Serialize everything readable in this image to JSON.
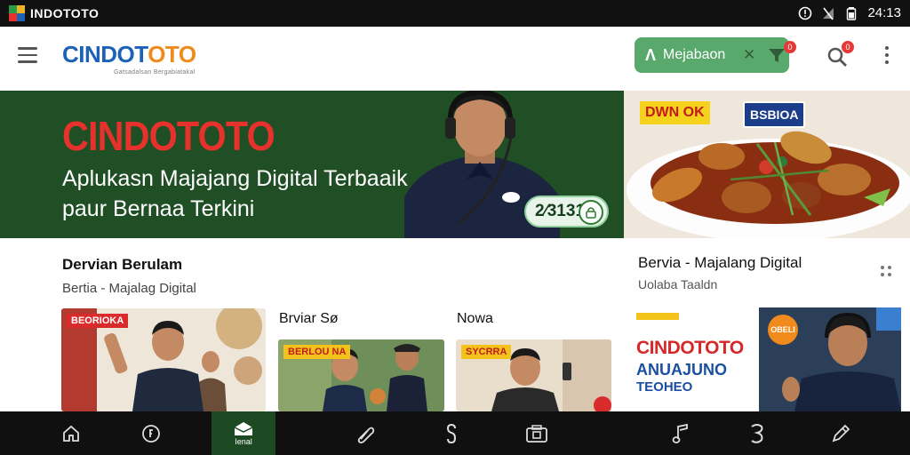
{
  "status_bar": {
    "app_name": "INDOTOTO",
    "time": "24:13"
  },
  "app_bar": {
    "brand_blue": "CINDOT",
    "brand_orange": "OTO",
    "brand_tagline": "Gatsadalsan Bergabiatakal"
  },
  "hero": {
    "title": "CINDOTOTO",
    "subtitle": "Aplukasn Majajang Digital Terbaaik paur Bernaa Terkini",
    "badge_text": "2⁄3131"
  },
  "section": {
    "title": "Dervian Berulam",
    "subtitle": "Bertia - Majalag Digital"
  },
  "cards": [
    {
      "label": "",
      "tag": "BEORIOKA"
    },
    {
      "label": "Brviar Sø",
      "tag": "BERLOU NA"
    },
    {
      "label": "Nowa",
      "tag": "SYCRRA"
    }
  ],
  "right_pane": {
    "search_pill_text": "Mejabaon",
    "filter_badge": "0",
    "search_badge": "0",
    "food_tag_left": "DWN OK",
    "food_tag_right": "BSBIOA",
    "title": "Bervia - Majalang Digital",
    "subtitle": "Uolaba Taaldn",
    "promo_title": "CINDOTOTO",
    "promo_line2": "ANUAJUNO",
    "promo_line3": "TEOHEO",
    "promo_card_badge": "OBELI"
  },
  "navbar": {
    "active_label": "Ienal"
  },
  "colors": {
    "hero_bg": "#214f25",
    "brand_blue": "#1b62b8",
    "brand_orange": "#f08a1c",
    "accent_red": "#e5322c",
    "pill_green": "#5aa96c"
  }
}
